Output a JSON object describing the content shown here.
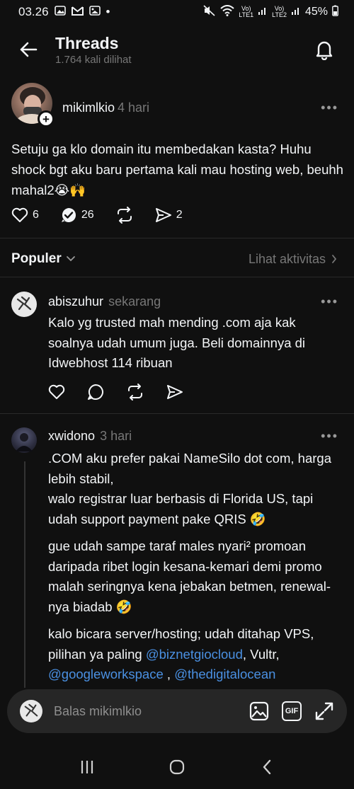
{
  "status_bar": {
    "time": "03.26",
    "dot": "•",
    "sim1": "LTE1",
    "sim2": "LTE2",
    "battery": "45%"
  },
  "header": {
    "title": "Threads",
    "views": "1.764 kali dilihat"
  },
  "post": {
    "username": "mikimlkio",
    "time": "4 hari",
    "text": "Setuju ga klo domain itu membedakan kasta? Huhu shock bgt aku baru pertama kali mau hosting web, beuhh mahal2😭🙌",
    "likes": "6",
    "replies": "26",
    "shares": "2",
    "more": "•••"
  },
  "sort": {
    "label": "Populer",
    "activity": "Lihat aktivitas"
  },
  "replies": [
    {
      "username": "abiszuhur",
      "time": "sekarang",
      "text": "Kalo yg trusted mah mending .com aja kak soalnya udah umum juga. Beli domainnya di Idwebhost 114 ribuan"
    },
    {
      "username": "xwidono",
      "time": "3 hari",
      "p1": ".COM aku prefer pakai NameSilo dot com, harga lebih stabil,",
      "p2": "walo registrar luar berbasis di Florida US, tapi udah support payment pake QRIS 🤣",
      "p3": "gue udah sampe taraf males nyari² promoan daripada ribet login kesana-kemari demi promo malah seringnya kena jebakan betmen, renewal-nya biadab 🤣",
      "p4_prefix": "kalo bicara server/hosting; udah ditahap VPS, pilihan ya paling ",
      "mention1": "@biznetgiocloud",
      "p4_mid": ", Vultr,",
      "mention2": "@googleworkspace",
      "p4_sep": " , ",
      "mention3": "@thedigitalocean"
    }
  ],
  "composer": {
    "placeholder": "Balas mikimlkio",
    "gif_label": "GIF"
  },
  "colors": {
    "background": "#101010",
    "text": "#f3f5f7",
    "muted": "#777777",
    "mention": "#4a90e2",
    "composer_bg": "#262626"
  }
}
